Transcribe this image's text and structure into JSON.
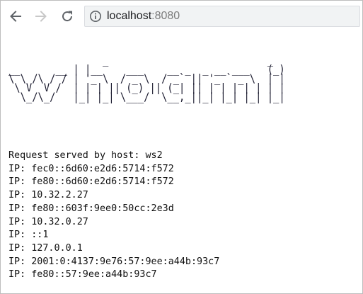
{
  "browser": {
    "url_host": "localhost",
    "url_port": ":8080",
    "icons": {
      "back": "arrow-left-icon",
      "forward": "arrow-right-icon",
      "reload": "reload-icon",
      "site_info": "info-circle-icon"
    },
    "colors": {
      "icon_active": "#5f6368",
      "icon_disabled": "#c8c8c8"
    }
  },
  "page": {
    "ascii_banner": "                _                           _ \n__      __ | |__    ___    __ _  _ __ ___   (_)\n\\ \\ /\\ / / | '_ \\  / _ \\  / _` || '_ ` _ \\  | |\n \\ V  V /  | | | || (_) || (_| || | | | | | | |\n  \\_/\\_/   |_| |_| \\___/  \\__,_||_| |_| |_| |_|",
    "lines": [
      "Request served by host: ws2",
      "IP: fec0::6d60:e2d6:5714:f572",
      "IP: fe80::6d60:e2d6:5714:f572",
      "IP: 10.32.2.27",
      "IP: fe80::603f:9ee0:50cc:2e3d",
      "IP: 10.32.0.27",
      "IP: ::1",
      "IP: 127.0.0.1",
      "IP: 2001:0:4137:9e76:57:9ee:a44b:93c7",
      "IP: fe80::57:9ee:a44b:93c7"
    ]
  }
}
